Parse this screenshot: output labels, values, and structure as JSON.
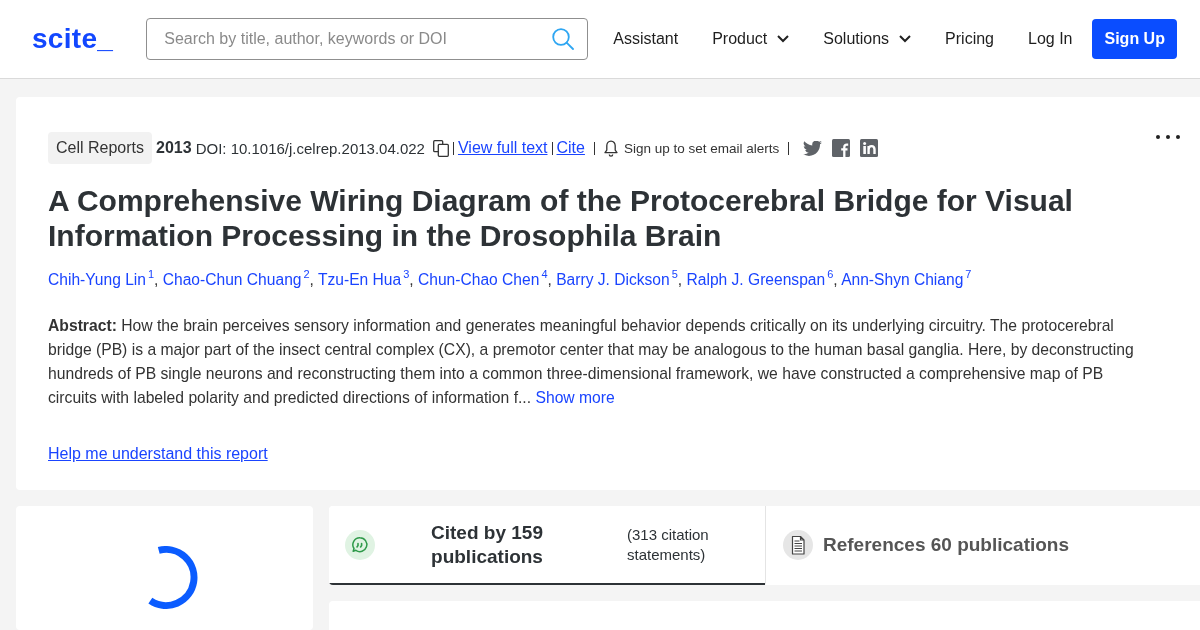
{
  "header": {
    "logo": "scite_",
    "search": {
      "placeholder": "Search by title, author, keywords or DOI"
    },
    "nav": [
      {
        "label": "Assistant",
        "kind": "link"
      },
      {
        "label": "Product",
        "kind": "dropdown"
      },
      {
        "label": "Solutions",
        "kind": "dropdown"
      },
      {
        "label": "Pricing",
        "kind": "link"
      },
      {
        "label": "Log In",
        "kind": "link"
      },
      {
        "label": "Sign Up",
        "kind": "button"
      }
    ]
  },
  "paper": {
    "journal": "Cell Reports",
    "year": "2013",
    "doi": "DOI: 10.1016/j.celrep.2013.04.022",
    "links": [
      "View full text",
      "Cite"
    ],
    "alert": "Sign up to set email alerts",
    "title": "A Comprehensive Wiring Diagram of the Protocerebral Bridge for Visual Information Processing in the Drosophila Brain",
    "authors": [
      {
        "name": "Chih-Yung Lin",
        "affiliation": "1",
        "separator": ","
      },
      {
        "name": "Chao-Chun Chuang",
        "affiliation": "2",
        "separator": ","
      },
      {
        "name": "Tzu-En Hua",
        "affiliation": "3",
        "separator": ","
      },
      {
        "name": "Chun-Chao Chen",
        "affiliation": "4",
        "separator": ","
      },
      {
        "name": "Barry J. Dickson",
        "affiliation": "5",
        "separator": ","
      },
      {
        "name": "Ralph J. Greenspan",
        "affiliation": "6",
        "separator": ","
      },
      {
        "name": "Ann-Shyn Chiang",
        "affiliation": "7"
      }
    ],
    "abstract": "**Abstract:** How the brain perceives sensory information and generates meaningful behavior depends critically on its underlying circuitry. The protocerebral bridge (PB) is a major part of the insect central complex (CX), a premotor center that may be analogous to the human basal ganglia. Here, by deconstructing hundreds of PB single neurons and reconstructing them into a common three-dimensional framework, we have constructed a comprehensive map of PB circuits with labeled polarity and predicted directions of information f...",
    "show_more": "Show more",
    "help_link": "Help me understand this report"
  },
  "tabs": [
    {
      "kind": "citations",
      "title": "Cited by 159 publications",
      "subtitle": "(313 citation statements)",
      "selected": true
    },
    {
      "kind": "references",
      "title": "References 60 publications",
      "selected": false
    }
  ]
}
